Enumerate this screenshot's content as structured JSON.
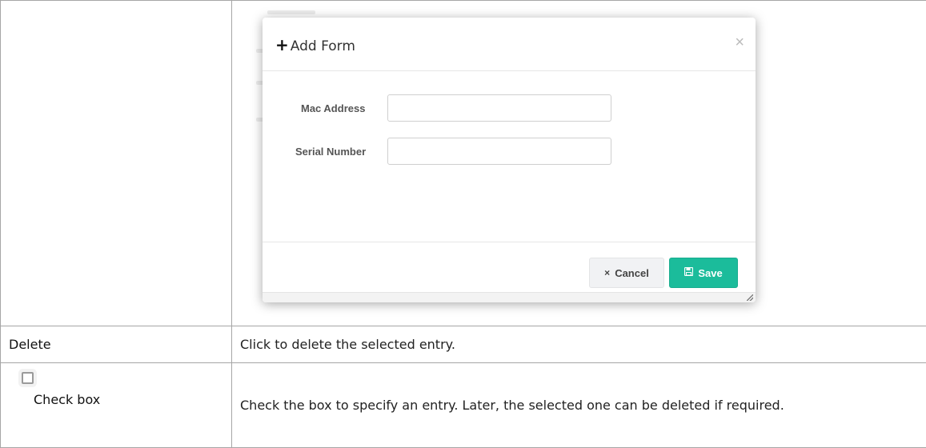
{
  "modal": {
    "title": "Add Form",
    "title_icon": "plus-icon",
    "close_symbol": "×",
    "fields": [
      {
        "label": "Mac Address",
        "value": "",
        "placeholder": ""
      },
      {
        "label": "Serial Number",
        "value": "",
        "placeholder": ""
      }
    ],
    "buttons": {
      "cancel_icon": "×",
      "cancel_label": "Cancel",
      "save_icon": "floppy-disk-icon",
      "save_label": "Save"
    },
    "save_color": "#1bbc9b"
  },
  "rows": [
    {
      "label": "Delete",
      "description": "Click to delete the selected entry."
    },
    {
      "label": "Check box",
      "icon": "checkbox-icon",
      "description": "Check the box to specify an entry. Later, the selected one can be deleted if required."
    }
  ]
}
